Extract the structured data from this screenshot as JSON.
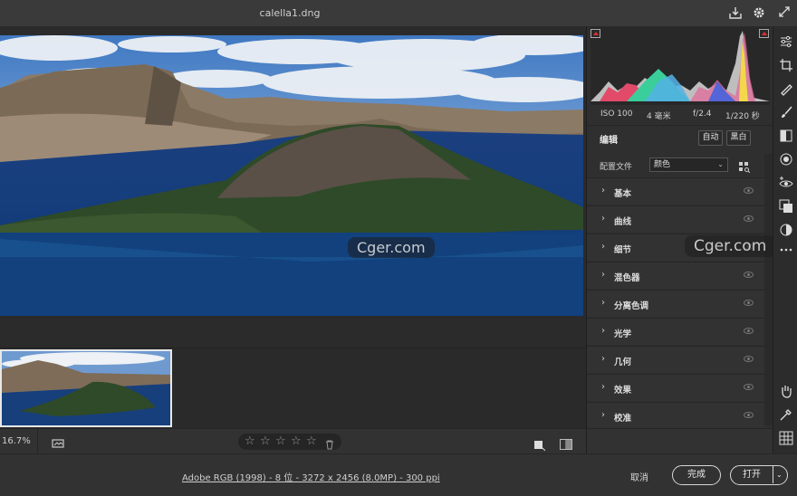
{
  "window": {
    "title": "calella1.dng"
  },
  "titlebar": {
    "save_icon": "save-icon",
    "settings_icon": "gear-icon",
    "fullscreen_icon": "fullscreen-icon"
  },
  "watermark": {
    "text": "Cger.com"
  },
  "exif": {
    "iso": "ISO 100",
    "focal": "4 毫米",
    "aperture": "f/2.4",
    "shutter": "1/220 秒"
  },
  "edit": {
    "title": "编辑",
    "auto": "自动",
    "bw": "黑白"
  },
  "profile": {
    "label": "配置文件",
    "value": "颜色"
  },
  "sections": [
    {
      "label": "基本"
    },
    {
      "label": "曲线"
    },
    {
      "label": "细节"
    },
    {
      "label": "混色器"
    },
    {
      "label": "分离色调"
    },
    {
      "label": "光学"
    },
    {
      "label": "几何"
    },
    {
      "label": "效果"
    },
    {
      "label": "校准"
    }
  ],
  "bottombar": {
    "zoom": "16.7%",
    "stars": [
      "☆",
      "☆",
      "☆",
      "☆",
      "☆"
    ],
    "rating": 0
  },
  "status": {
    "info": "Adobe RGB (1998) - 8 位 - 3272 x 2456 (8.0MP) - 300 ppi",
    "cancel": "取消",
    "done": "完成",
    "open": "打开"
  },
  "colors": {
    "bg": "#323232",
    "panel": "#2f2f2f",
    "clip_warning": "#e03030"
  }
}
